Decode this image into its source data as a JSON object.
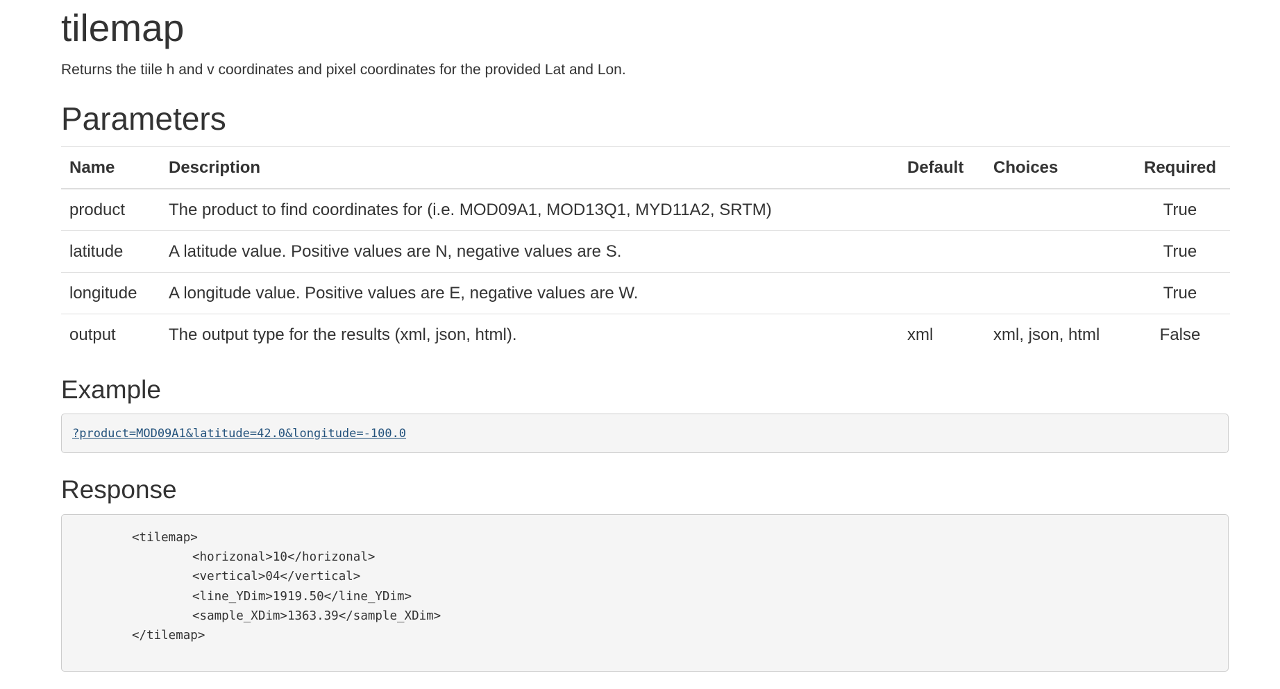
{
  "header": {
    "title": "tilemap",
    "subtitle": "Returns the tiile h and v coordinates and pixel coordinates for the provided Lat and Lon."
  },
  "parameters": {
    "heading": "Parameters",
    "columns": {
      "name": "Name",
      "description": "Description",
      "default": "Default",
      "choices": "Choices",
      "required": "Required"
    },
    "rows": [
      {
        "name": "product",
        "description": "The product to find coordinates for (i.e. MOD09A1, MOD13Q1, MYD11A2, SRTM)",
        "default": "",
        "choices": "",
        "required": "True"
      },
      {
        "name": "latitude",
        "description": "A latitude value. Positive values are N, negative values are S.",
        "default": "",
        "choices": "",
        "required": "True"
      },
      {
        "name": "longitude",
        "description": "A longitude value. Positive values are E, negative values are W.",
        "default": "",
        "choices": "",
        "required": "True"
      },
      {
        "name": "output",
        "description": "The output type for the results (xml, json, html).",
        "default": "xml",
        "choices": "xml, json, html",
        "required": "False"
      }
    ]
  },
  "example": {
    "heading": "Example",
    "link_text": "?product=MOD09A1&latitude=42.0&longitude=-100.0"
  },
  "response": {
    "heading": "Response",
    "lines": [
      "<tilemap>",
      "<horizonal>10</horizonal>",
      "<vertical>04</vertical>",
      "<line_YDim>1919.50</line_YDim>",
      "<sample_XDim>1363.39</sample_XDim>",
      "</tilemap>"
    ]
  }
}
